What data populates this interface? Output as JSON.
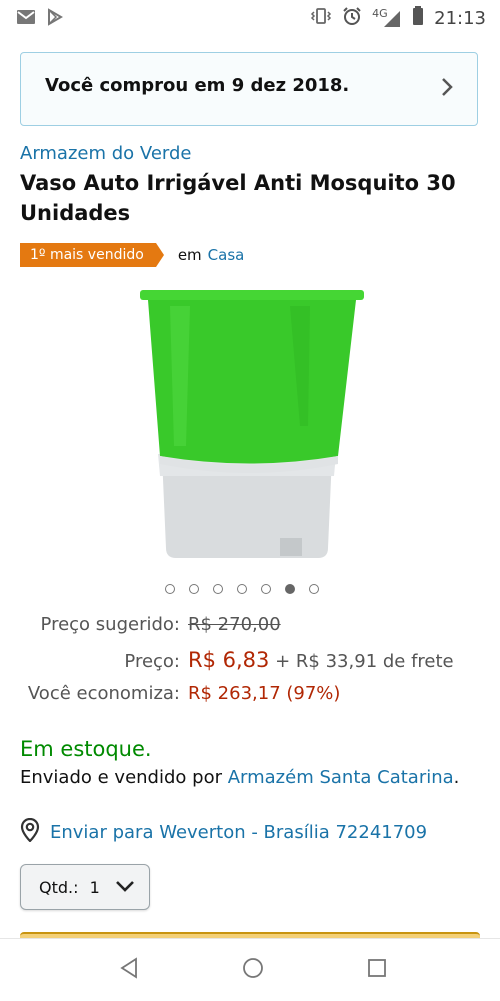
{
  "status_bar": {
    "left_icons": [
      "gmail-icon",
      "play-store-icon"
    ],
    "right_icons": [
      "vibrate-icon",
      "alarm-icon",
      "signal-4g-icon",
      "battery-icon"
    ],
    "network": "4G",
    "time": "21:13"
  },
  "purchase_notice": {
    "text": "Você comprou em 9 dez 2018.",
    "icon": "chevron-right-icon"
  },
  "product": {
    "brand": "Armazem do Verde",
    "title": "Vaso Auto Irrigável Anti Mosquito 30 Unidades",
    "badge": "1º mais vendido",
    "category_prefix": "em",
    "category": "Casa",
    "image": {
      "pot_color": "#39c92a",
      "base_color": "#d9dcde",
      "images_total": 7,
      "active_image": 6
    }
  },
  "pricing": {
    "suggested_label": "Preço sugerido:",
    "suggested_value": "R$ 270,00",
    "price_label": "Preço:",
    "price_value": "R$ 6,83",
    "shipping": "+ R$ 33,91 de frete",
    "savings_label": "Você economiza:",
    "savings_value": "R$ 263,17 (97%)"
  },
  "availability": {
    "stock": "Em estoque.",
    "sold_by_prefix": "Enviado e vendido por",
    "seller": "Armazém Santa Catarina",
    "sold_by_suffix": "."
  },
  "delivery": {
    "text": "Enviar para Weverton - Brasília 72241709",
    "icon": "location-pin-icon"
  },
  "quantity": {
    "label": "Qtd.:",
    "value": "1"
  },
  "nav_bar": {
    "icons": [
      "back-icon",
      "home-icon",
      "recents-icon"
    ]
  },
  "colors": {
    "link": "#1a73a8",
    "price_red": "#b12704",
    "stock_green": "#008a00",
    "badge_orange": "#e47911",
    "notice_border": "#9ecfe3"
  }
}
